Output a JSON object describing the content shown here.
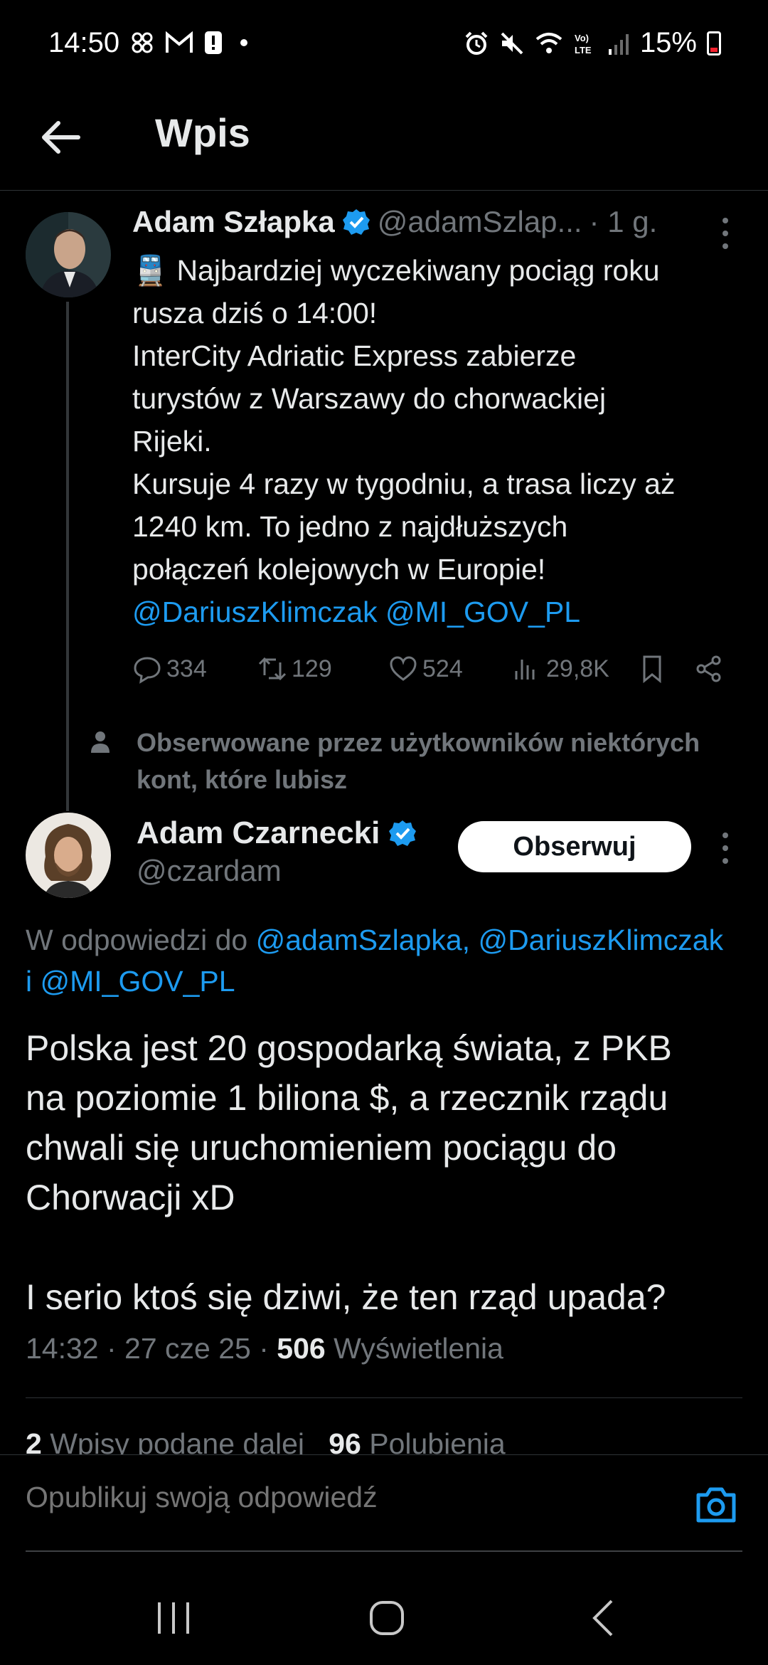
{
  "status_bar": {
    "time": "14:50",
    "battery": "15%",
    "left_icons": [
      "pinwheel-icon",
      "gmail-icon",
      "alert-icon",
      "dot-icon"
    ],
    "right_icons": [
      "alarm-icon",
      "mute-icon",
      "wifi-icon",
      "volte-icon",
      "signal-icon",
      "battery-icon"
    ]
  },
  "header": {
    "title": "Wpis"
  },
  "tweet1": {
    "author_name": "Adam Szłapka",
    "handle": "@adamSzlap...",
    "time": "· 1 g.",
    "lines": [
      "🚆 Najbardziej wyczekiwany pociąg roku",
      "rusza dziś o 14:00!",
      "InterCity Adriatic Express zabierze",
      "turystów z Warszawy do chorwackiej",
      "Rijeki.",
      "Kursuje 4 razy w tygodniu, a trasa liczy aż",
      "1240 km. To jedno z najdłuższych",
      "połączeń kolejowych w Europie!"
    ],
    "mentions": "@DariuszKlimczak @MI_GOV_PL",
    "replies": "334",
    "reposts": "129",
    "likes": "524",
    "views": "29,8K"
  },
  "social_context": {
    "line1": "Obserwowane przez użytkowników niektórych",
    "line2": "kont, które lubisz"
  },
  "tweet2": {
    "author_name": "Adam Czarnecki",
    "handle": "@czardam",
    "follow_label": "Obserwuj",
    "reply_prefix": "W odpowiedzi do ",
    "reply_to_line1": "@adamSzlapka, @DariuszKlimczak",
    "reply_conj": "i ",
    "reply_to_line2": "@MI_GOV_PL",
    "body_lines": [
      "Polska jest 20 gospodarką świata, z PKB",
      "na poziomie 1 biliona $, a rzecznik rządu",
      "chwali się uruchomieniem pociągu do",
      "Chorwacji xD"
    ],
    "body_line_last": "I serio ktoś się dziwi, że ten rząd upada?",
    "timestamp": "14:32 · 27 cze 25 · ",
    "views_count": "506",
    "views_label": " Wyświetlenia",
    "reposts_count": "2",
    "reposts_label": " Wpisy podane dalej",
    "likes_count": "96",
    "likes_label": " Polubienia"
  },
  "compose": {
    "placeholder": "Opublikuj swoją odpowiedź"
  },
  "colors": {
    "background": "#000000",
    "text": "#e7e9ea",
    "muted": "#71767b",
    "link": "#1d9bf0",
    "divider": "#2f3336"
  }
}
